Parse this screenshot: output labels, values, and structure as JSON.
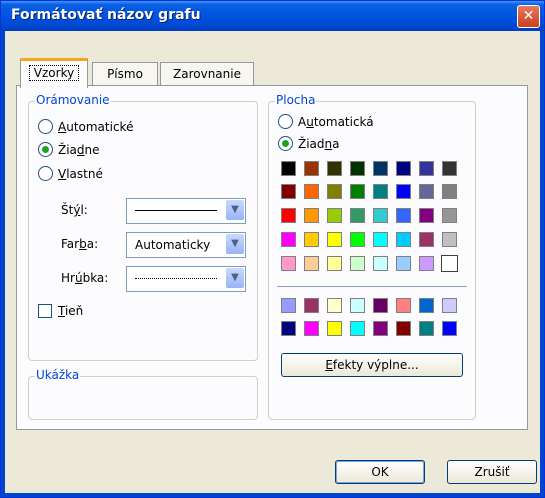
{
  "window": {
    "title": "Formátovať názov grafu",
    "close_glyph": "✕"
  },
  "tabs": [
    {
      "label": "Vzorky",
      "active": true
    },
    {
      "label": "Písmo",
      "active": false
    },
    {
      "label": "Zarovnanie",
      "active": false
    }
  ],
  "border_group": {
    "legend": "Orámovanie",
    "options": [
      {
        "label_pre": "",
        "mnemonic": "A",
        "label_post": "utomatické",
        "selected": false
      },
      {
        "label_pre": "Žia",
        "mnemonic": "d",
        "label_post": "ne",
        "selected": true
      },
      {
        "label_pre": "",
        "mnemonic": "V",
        "label_post": "lastné",
        "selected": false
      }
    ],
    "style_label_pre": "Št",
    "style_label_mn": "ý",
    "style_label_post": "l:",
    "color_label_pre": "Far",
    "color_label_mn": "b",
    "color_label_post": "a:",
    "color_value": "Automaticky",
    "weight_label_pre": "Hr",
    "weight_label_mn": "ú",
    "weight_label_post": "bka:",
    "shadow_mn": "T",
    "shadow_post": "ieň"
  },
  "preview_group": {
    "legend": "Ukážka"
  },
  "area_group": {
    "legend": "Plocha",
    "options": [
      {
        "label_pre": "A",
        "mnemonic": "u",
        "label_post": "tomatická",
        "selected": false
      },
      {
        "label_pre": "Žiad",
        "mnemonic": "n",
        "label_post": "a",
        "selected": true
      }
    ],
    "palette_rows": [
      [
        "#000000",
        "#993300",
        "#333300",
        "#003300",
        "#003366",
        "#000080",
        "#333399",
        "#333333"
      ],
      [
        "#800000",
        "#ff6600",
        "#808000",
        "#008000",
        "#008080",
        "#0000ff",
        "#666699",
        "#808080"
      ],
      [
        "#ff0000",
        "#ff9900",
        "#99cc00",
        "#339966",
        "#33cccc",
        "#3366ff",
        "#800080",
        "#969696"
      ],
      [
        "#ff00ff",
        "#ffcc00",
        "#ffff00",
        "#00ff00",
        "#00ffff",
        "#00ccff",
        "#993366",
        "#c0c0c0"
      ],
      [
        "#ff99cc",
        "#ffcc99",
        "#ffff99",
        "#ccffcc",
        "#ccffff",
        "#99ccff",
        "#cc99ff",
        "#ffffff"
      ]
    ],
    "chart_rows": [
      [
        "#9999ff",
        "#993366",
        "#ffffcc",
        "#ccffff",
        "#660066",
        "#ff8080",
        "#0066cc",
        "#ccccff"
      ],
      [
        "#000080",
        "#ff00ff",
        "#ffff00",
        "#00ffff",
        "#800080",
        "#800000",
        "#008080",
        "#0000ff"
      ]
    ],
    "fill_effects_mn": "E",
    "fill_effects_post": "fekty výplne..."
  },
  "footer": {
    "ok_label": "OK",
    "cancel_label": "Zrušiť"
  }
}
